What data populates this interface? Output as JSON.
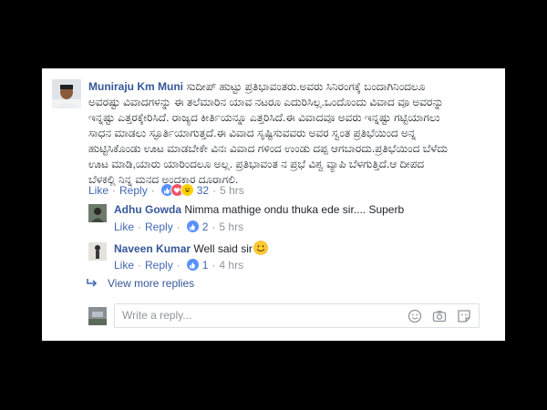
{
  "comment": {
    "author": "Muniraju Km Muni",
    "lines": [
      "ಸುದೀಪ್ ಹುಟ್ಟು ಪ್ರತಿಭಾವಂತರು.ಅವರು ಸಿನಿರಂಗಕ್ಕೆ ಬಂದಾಗಿನಿಂದಲೂ",
      "ಅವರಷ್ಟು ವಿವಾದಗಳನ್ನು ಈ ತಲೆಮಾರಿನ ಯಾವ ನಟರೂ ಎದುರಿಸಿಲ್ಲ.ಒಂದೊಂದು ವಿವಾದ ವೂ ಅವರನ್ನು",
      "ಇನ್ನಷ್ಟು ಎತ್ತರಕ್ಕೇರಿಸಿದೆ. ರಾಜ್ಯದ ಕೀರ್ತಿಯನ್ನೂ ಎತ್ತರಿಸಿದೆ.ಈ ವಿವಾದವೂ ಅವರು ಇನ್ನಷ್ಟು ಗಟ್ಟಿಯಾಗಲು",
      "ಸಾಧನ ಮಾಡಲು ಸ್ಫೂರ್ತಿಯಾಗುತ್ತದೆ.ಈ ವಿವಾದ ಸೃಷ್ಟಿಸುವವರು ಅವರ ಸ್ವಂತ ಪ್ರತಿಭೆಯಿಂದ ಅನ್ನ",
      "ಹುಟ್ಟಿಸಿಕೊಂಡು ಊಟ ಮಾಡಬೇಕೇ ವಿನಃ ವಿವಾದ ಗಳಿಂದ ಉಂಡು ದಪ್ಪ ಆಗಬಾರದು.ಪ್ರತಿಭೆಯಿಂದ ಬೆಳೆದು",
      "ಊಟ ಮಾಡಿ,ಯಾರು ಯಾರಿಂದಲೂ ಅಲ್ಲ. ಪ್ರತಿಭಾವಂತ ನ ಪ್ರಭೆ ವಿಶ್ವ ವ್ಯಾಪಿ ಬೆಳಗುತ್ತಿದೆ.ಆ ದೀಪದ",
      "ಬೆಳಕಲ್ಲಿ ನಿನ್ನ ಮನದ ಅಂಧಕಾರ ದೂರಾಗಲಿ."
    ],
    "like_label": "Like",
    "reply_label": "Reply",
    "reaction_count": "32",
    "time": "5 hrs"
  },
  "replies": [
    {
      "author": "Adhu Gowda",
      "text": "Nimma mathige ondu thuka ede sir.... Superb",
      "like_label": "Like",
      "reply_label": "Reply",
      "reaction_count": "2",
      "time": "5 hrs"
    },
    {
      "author": "Naveen Kumar",
      "text": "Well said sir",
      "like_label": "Like",
      "reply_label": "Reply",
      "reaction_count": "1",
      "time": "4 hrs"
    }
  ],
  "view_more": "View more replies",
  "reply_box": {
    "placeholder": "Write a reply..."
  },
  "colors": {
    "link": "#365899",
    "action": "#4267b2",
    "meta": "#90949c",
    "like_blue": "#5890ff",
    "love_red": "#f25268",
    "haha_yellow": "#ffd100"
  },
  "icons": [
    "like-reaction-icon",
    "love-reaction-icon",
    "haha-reaction-icon",
    "reply-arrow-icon",
    "emoji-icon",
    "camera-icon",
    "sticker-icon",
    "smiley-emoji"
  ]
}
